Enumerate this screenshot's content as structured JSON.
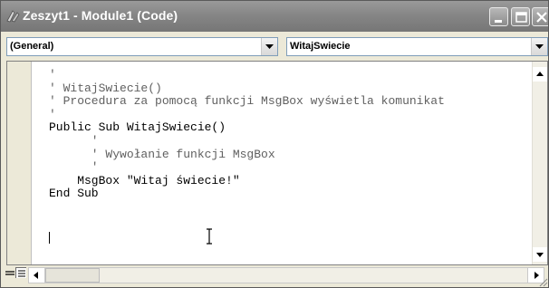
{
  "window": {
    "title": "Zeszyt1 - Module1 (Code)"
  },
  "object_combo": {
    "value": "(General)"
  },
  "procedure_combo": {
    "value": "WitajSwiecie"
  },
  "code_lines": [
    {
      "text": "'",
      "kind": "comment"
    },
    {
      "text": "' WitajSwiecie()",
      "kind": "comment"
    },
    {
      "text": "' Procedura za pomocą funkcji MsgBox wyświetla komunikat",
      "kind": "comment"
    },
    {
      "text": "'",
      "kind": "comment"
    },
    {
      "text": "Public Sub WitajSwiecie()",
      "kind": "code"
    },
    {
      "text": "      '",
      "kind": "comment"
    },
    {
      "text": "      ' Wywołanie funkcji MsgBox",
      "kind": "comment"
    },
    {
      "text": "      '",
      "kind": "comment"
    },
    {
      "text": "    MsgBox \"Witaj świecie!\"",
      "kind": "code"
    },
    {
      "text": "End Sub",
      "kind": "code"
    }
  ],
  "icons": {
    "title": "vba-module-icon",
    "minimize": "minimize-icon",
    "maximize": "maximize-icon",
    "close": "close-icon"
  }
}
